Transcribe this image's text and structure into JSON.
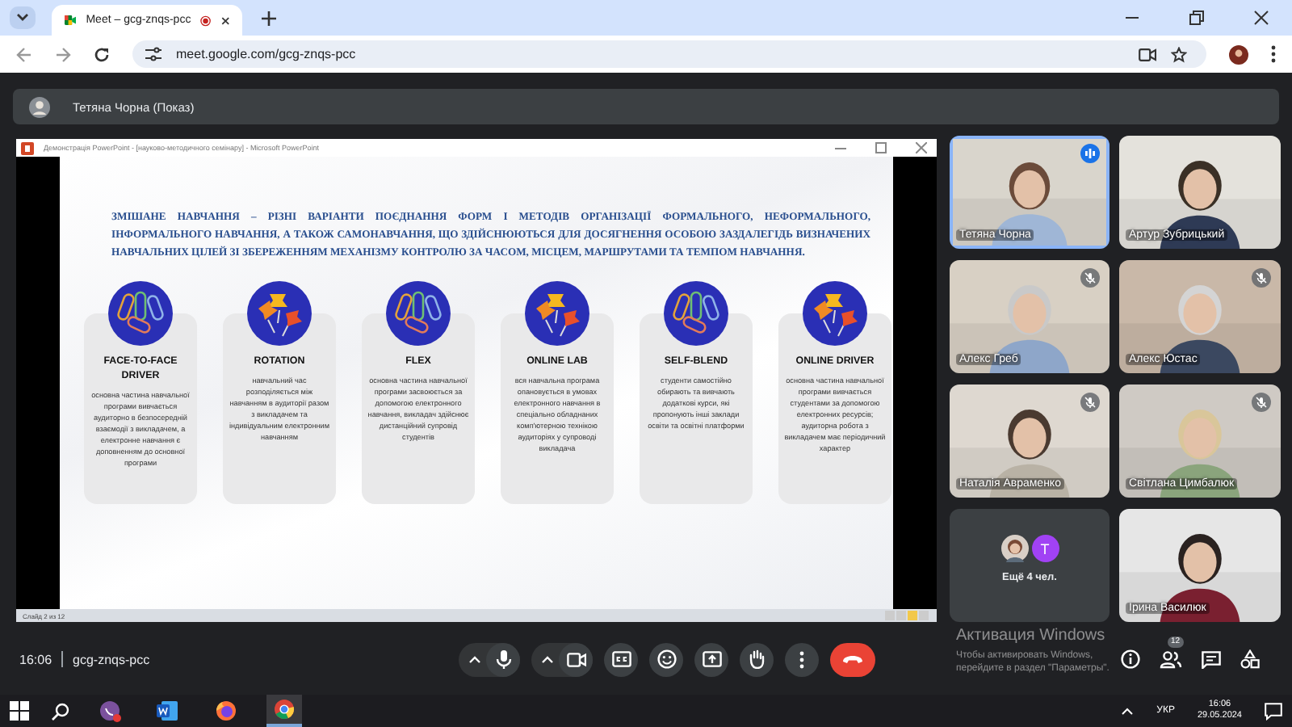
{
  "browser": {
    "tab": {
      "title": "Meet – gcg-znqs-pcc",
      "recording": true
    },
    "url": "meet.google.com/gcg-znqs-pcc"
  },
  "presenter_bar": {
    "label": "Тетяна Чорна (Показ)"
  },
  "presentation": {
    "window_title": "Демонстрація PowerPoint - [науково-методичного семінару] - Microsoft PowerPoint",
    "status": "Слайд 2 из 12",
    "slide": {
      "intro": "ЗМІШАНЕ НАВЧАННЯ – РІЗНІ ВАРІАНТИ ПОЄДНАННЯ ФОРМ І МЕТОДІВ ОРГАНІЗАЦІЇ ФОРМАЛЬНОГО, НЕФОРМАЛЬНОГО, ІНФОРМАЛЬНОГО НАВЧАННЯ, А ТАКОЖ САМОНАВЧАННЯ, ЩО ЗДІЙСНЮЮТЬСЯ ДЛЯ ДОСЯГНЕННЯ ОСОБОЮ ЗАЗДАЛЕГІДЬ ВИЗНАЧЕНИХ НАВЧАЛЬНИХ ЦІЛЕЙ ЗІ ЗБЕРЕЖЕННЯМ МЕХАНІЗМУ КОНТРОЛЮ ЗА ЧАСОМ, МІСЦЕМ, МАРШРУТАМИ ТА ТЕМПОМ НАВЧАННЯ.",
      "cards": [
        {
          "kind": "clips",
          "title": "FACE-TO-FACE DRIVER",
          "text": "основна частина навчальної програми вивчається аудиторно в безпосередній взаємодії з викладачем, а електронне навчання є доповненням до основної програми"
        },
        {
          "kind": "pins",
          "title": "ROTATION",
          "text": "навчальний час розподіляється між навчанням в аудиторії разом з викладачем та індивідуальним електронним навчанням"
        },
        {
          "kind": "clips",
          "title": "FLEX",
          "text": "основна частина навчальної програми засвоюється за допомогою електронного навчання, викладач здійснює дистанційний супровід студентів"
        },
        {
          "kind": "pins",
          "title": "ONLINE LAB",
          "text": "вся навчальна програма опановується в умовах електронного навчання в спеціально обладнаних комп'ютерною технікою аудиторіях у супроводі викладача"
        },
        {
          "kind": "clips",
          "title": "SELF-BLEND",
          "text": "студенти самостійно обирають та вивчають додаткові курси, які пропонують інші заклади освіти та освітні платформи"
        },
        {
          "kind": "pins",
          "title": "ONLINE DRIVER",
          "text": "основна частина навчальної програми вивчається студентами за допомогою електронних ресурсів; аудиторна робота з викладачем має періодичний характер"
        }
      ]
    }
  },
  "tiles": [
    {
      "kind": "video",
      "name": "Тетяна Чорна",
      "speaking": true,
      "muted": false
    },
    {
      "kind": "video",
      "name": "Артур Зубрицький",
      "speaking": false,
      "muted": false
    },
    {
      "kind": "video",
      "name": "Алекс Греб",
      "speaking": false,
      "muted": true
    },
    {
      "kind": "video",
      "name": "Алекс Юстас",
      "speaking": false,
      "muted": true
    },
    {
      "kind": "video",
      "name": "Наталія Авраменко",
      "speaking": false,
      "muted": true
    },
    {
      "kind": "video",
      "name": "Світлана Цимбалюк",
      "speaking": false,
      "muted": true
    },
    {
      "kind": "more",
      "label": "Ещё 4 чел.",
      "avatars": [
        {
          "kind": "picture"
        },
        {
          "kind": "letter",
          "letter": "T",
          "color": "#a142f4"
        }
      ]
    },
    {
      "kind": "video",
      "name": "Ірина Василюк",
      "speaking": false,
      "muted": false
    }
  ],
  "activation": {
    "title": "Активация Windows",
    "text": "Чтобы активировать Windows, перейдите в раздел \"Параметры\"."
  },
  "bottom_bar": {
    "time": "16:06",
    "meeting_code": "gcg-znqs-pcc",
    "people_count": "12"
  },
  "taskbar": {
    "language": "УКР",
    "time": "16:06",
    "date": "29.05.2024"
  }
}
